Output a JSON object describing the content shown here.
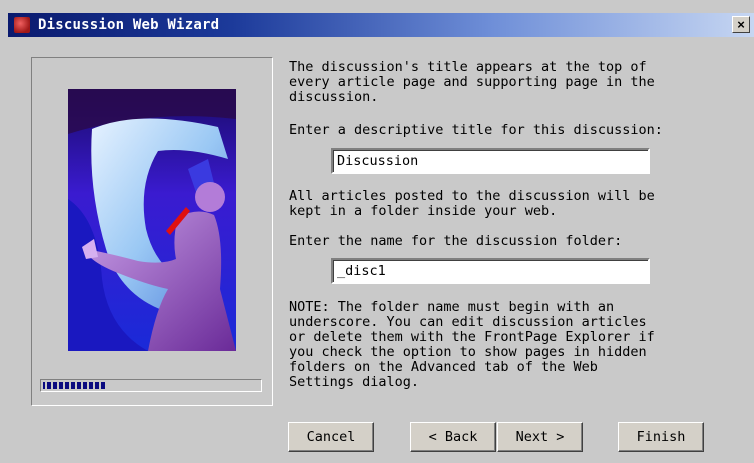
{
  "window": {
    "title": "Discussion Web Wizard",
    "close_label": "×",
    "icon": "frontpage-app-icon"
  },
  "content": {
    "intro_text": "The discussion's title appears at the top of\nevery article page and supporting page in the\ndiscussion.",
    "title_label": "Enter a descriptive title for this discussion:",
    "title_value": "Discussion",
    "folder_intro_text": "All articles posted to the discussion will be\nkept in a folder inside your web.",
    "folder_label": "Enter the name for the discussion folder:",
    "folder_value": "_disc1",
    "note_text": "NOTE: The folder name must begin with an\nunderscore. You can edit discussion articles\nor delete them with the FrontPage Explorer if\nyou check the option to show pages in hidden\nfolders on the Advanced tab of the Web\nSettings dialog."
  },
  "progress": {
    "fraction": 0.3
  },
  "buttons": {
    "cancel": "Cancel",
    "back": "< Back",
    "next": "Next >",
    "finish": "Finish"
  },
  "colors": {
    "titlebar_start": "#0a1a6e",
    "titlebar_end": "#c6d6f2",
    "dialog_bg": "#c9c9c9",
    "progress_fill": "#0a0a80"
  }
}
